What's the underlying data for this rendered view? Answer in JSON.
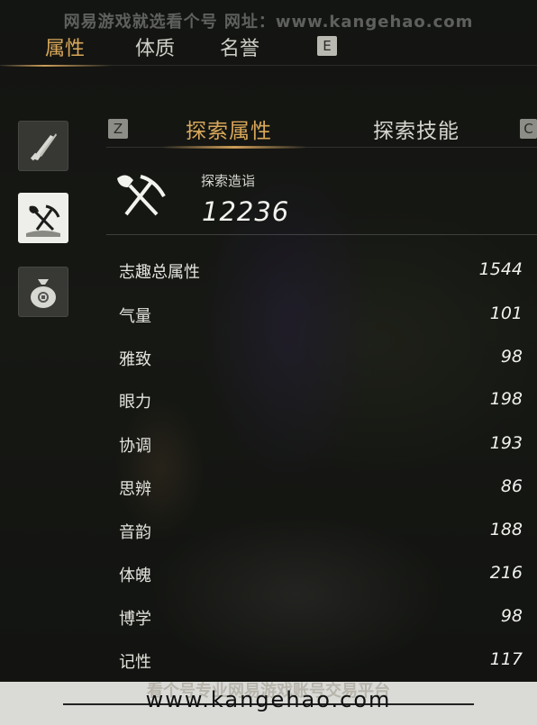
{
  "watermark": {
    "top": "网易游戏就选看个号   网址：www.kangehao.com",
    "bottom_url": "www.kangehao.com",
    "bottom_ghost": "看个号专业网易游戏账号交易平台"
  },
  "top_tabs": [
    "属性",
    "体质",
    "名誉"
  ],
  "keys": {
    "next_top": "E",
    "prev_sub": "Z",
    "next_sub": "C"
  },
  "sub_tabs": [
    "探索属性",
    "探索技能"
  ],
  "side_icons": [
    "weapon-icon",
    "shovel-pickaxe-icon",
    "money-bag-icon"
  ],
  "summary": {
    "label": "探索造诣",
    "value": "12236",
    "icon": "shovel-pickaxe-icon"
  },
  "stats": [
    {
      "name": "志趣总属性",
      "value": "1544"
    },
    {
      "name": "气量",
      "value": "101"
    },
    {
      "name": "雅致",
      "value": "98"
    },
    {
      "name": "眼力",
      "value": "198"
    },
    {
      "name": "协调",
      "value": "193"
    },
    {
      "name": "思辨",
      "value": "86"
    },
    {
      "name": "音韵",
      "value": "188"
    },
    {
      "name": "体魄",
      "value": "216"
    },
    {
      "name": "博学",
      "value": "98"
    },
    {
      "name": "记性",
      "value": "117"
    }
  ],
  "colors": {
    "accent": "#d9a85a",
    "text": "#e4e4de",
    "panel_active": "#eeeeea"
  }
}
